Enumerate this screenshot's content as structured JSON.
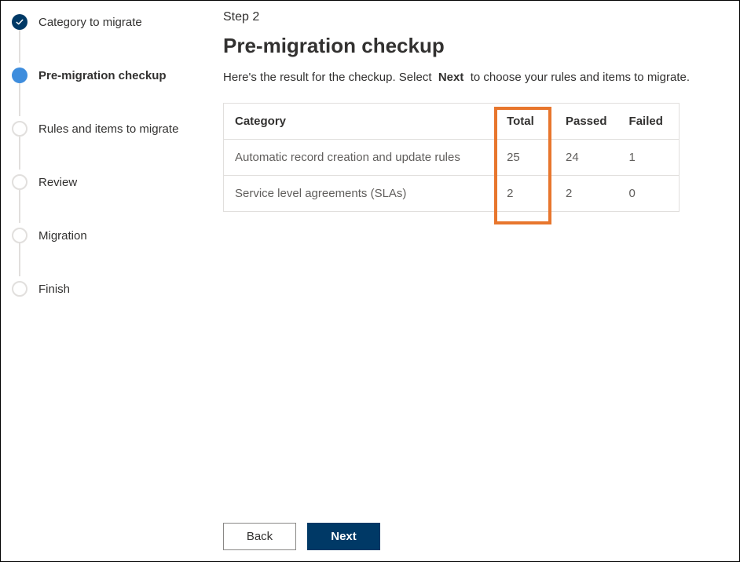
{
  "sidebar": {
    "steps": [
      {
        "label": "Category to migrate",
        "state": "done"
      },
      {
        "label": "Pre-migration checkup",
        "state": "current"
      },
      {
        "label": "Rules and items to migrate",
        "state": "pending"
      },
      {
        "label": "Review",
        "state": "pending"
      },
      {
        "label": "Migration",
        "state": "pending"
      },
      {
        "label": "Finish",
        "state": "pending"
      }
    ]
  },
  "main": {
    "step_indicator": "Step 2",
    "title": "Pre-migration checkup",
    "description_pre": "Here's the result for the checkup. Select ",
    "description_kw": "Next",
    "description_post": " to choose your rules and items to migrate."
  },
  "table": {
    "headers": {
      "category": "Category",
      "total": "Total",
      "passed": "Passed",
      "failed": "Failed"
    },
    "rows": [
      {
        "category": "Automatic record creation and update rules",
        "total": "25",
        "passed": "24",
        "failed": "1"
      },
      {
        "category": "Service level agreements (SLAs)",
        "total": "2",
        "passed": "2",
        "failed": "0"
      }
    ]
  },
  "footer": {
    "back": "Back",
    "next": "Next"
  },
  "colors": {
    "brand_dark": "#003966",
    "accent": "#3e8ddd",
    "highlight_box": "#e8762d"
  }
}
